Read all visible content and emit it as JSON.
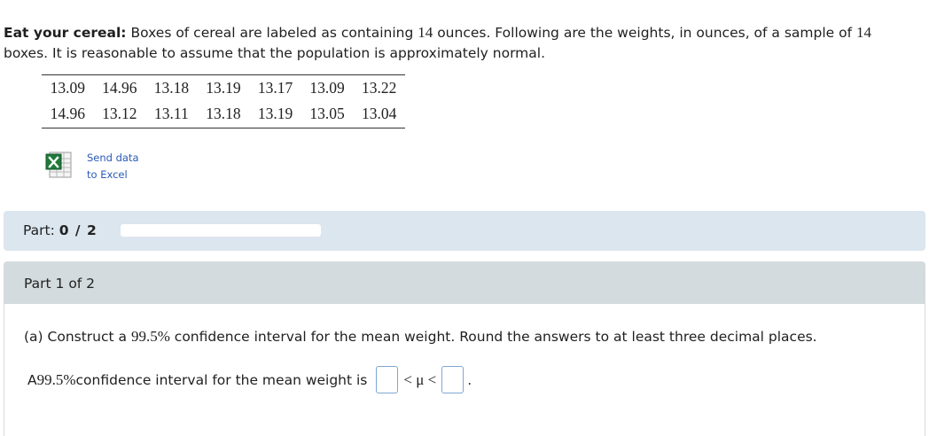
{
  "intro": {
    "title": "Eat your cereal:",
    "text_1": " Boxes of cereal are labeled as containing ",
    "labeled_weight": "14",
    "text_2": " ounces. Following are the weights, in ounces, of a sample of ",
    "sample_size": "14",
    "text_3": " boxes. It is reasonable to assume that the population is approximately normal."
  },
  "data_table": {
    "rows": [
      [
        "13.09",
        "14.96",
        "13.18",
        "13.19",
        "13.17",
        "13.09",
        "13.22"
      ],
      [
        "14.96",
        "13.12",
        "13.11",
        "13.18",
        "13.19",
        "13.05",
        "13.04"
      ]
    ]
  },
  "excel": {
    "icon": "excel-icon",
    "line_1": "Send data",
    "line_2": "to Excel"
  },
  "part_progress": {
    "label": "Part: ",
    "value": "0 / 2",
    "fraction_complete": 0
  },
  "question": {
    "header": "Part 1 of 2",
    "prompt_1": "(a) Construct a ",
    "confidence": "99.5%",
    "prompt_2": " confidence interval for the mean weight. Round the answers to at least three decimal places.",
    "answer_prefix_1": "A ",
    "answer_prefix_2": " confidence interval for the mean weight is",
    "inequality": "< μ <",
    "period": "."
  }
}
